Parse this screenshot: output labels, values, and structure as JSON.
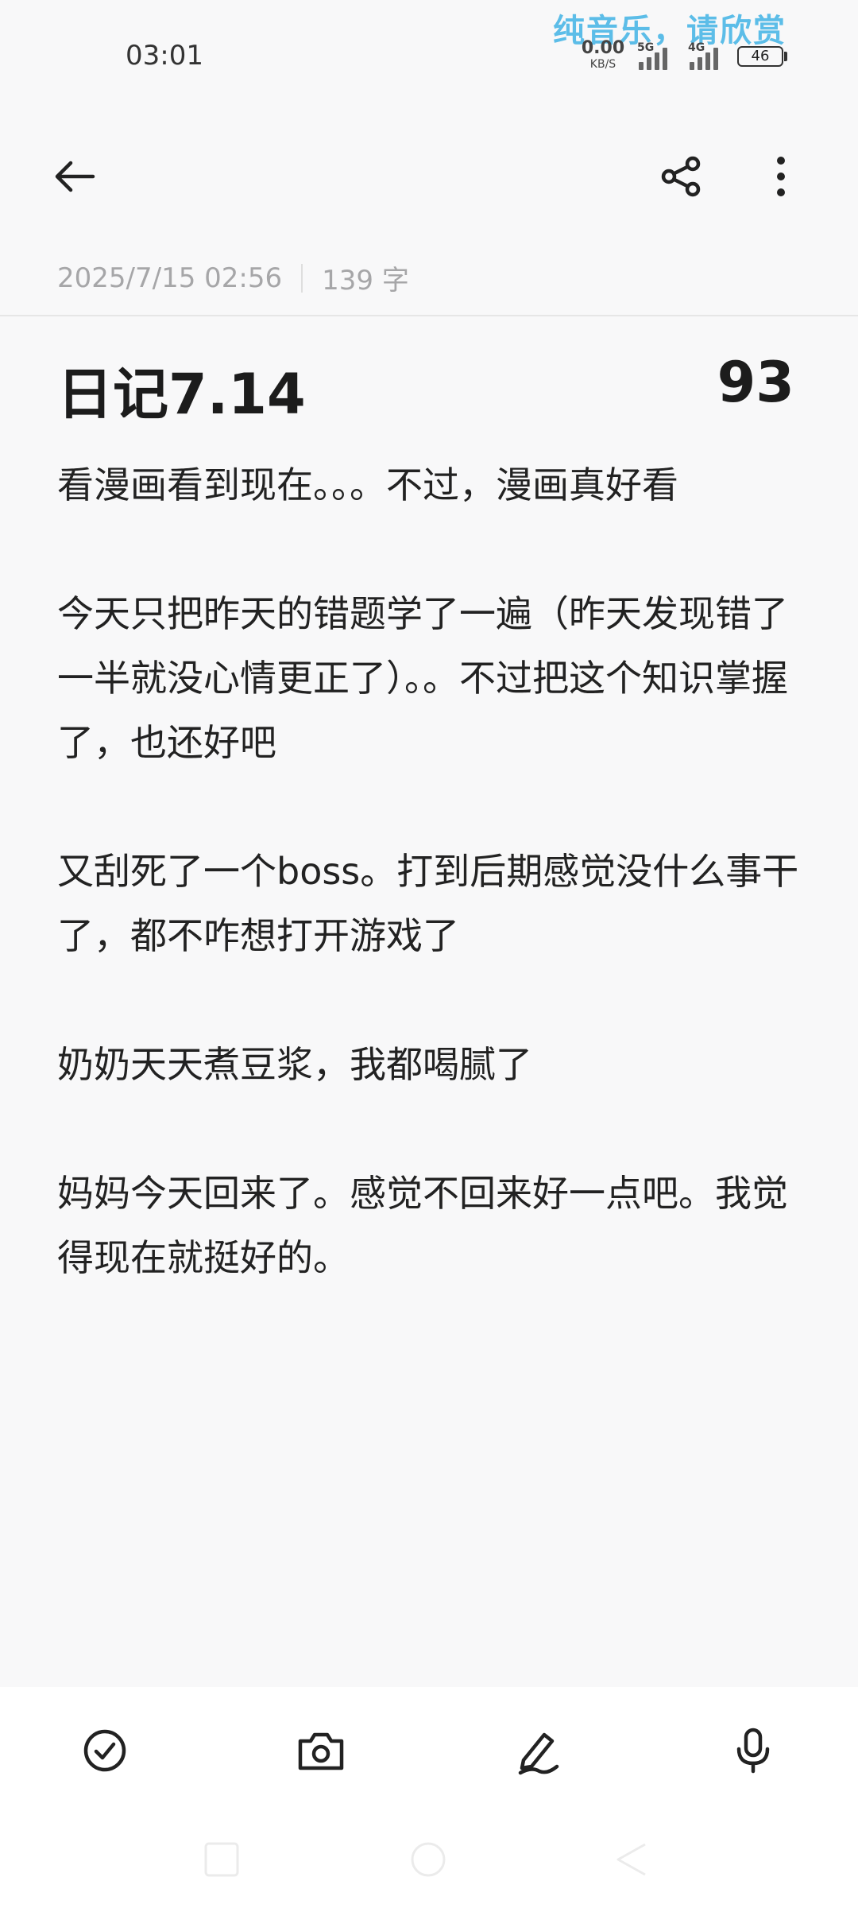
{
  "status_bar": {
    "time": "03:01",
    "music_banner": "纯音乐，请欣赏",
    "net_speed_value": "0.00",
    "net_speed_unit": "KB/S",
    "signal_1_label": "5G",
    "signal_2_label": "4G",
    "battery_level": "46"
  },
  "header": {
    "back_icon": "arrow-left-icon",
    "share_icon": "share-icon",
    "more_icon": "more-vertical-icon"
  },
  "note": {
    "datetime": "2025/7/15 02:56",
    "word_count": "139 字",
    "title": "日记7.14",
    "number": "93",
    "paragraphs": [
      "看漫画看到现在。。。不过，漫画真好看",
      "今天只把昨天的错题学了一遍（昨天发现错了一半就没心情更正了）。。不过把这个知识掌握了，也还好吧",
      "又刮死了一个boss。打到后期感觉没什么事干了，都不咋想打开游戏了",
      "奶奶天天煮豆浆，我都喝腻了",
      "妈妈今天回来了。感觉不回来好一点吧。我觉得现在就挺好的。"
    ]
  },
  "toolbar": {
    "check_icon": "checklist-icon",
    "camera_icon": "camera-icon",
    "pen_icon": "handwriting-icon",
    "mic_icon": "microphone-icon"
  },
  "colors": {
    "background": "#f8f8f9",
    "music_banner": "#5cbde8",
    "meta_text": "#a6a6a8",
    "toolbar_bg": "#ffffff"
  }
}
